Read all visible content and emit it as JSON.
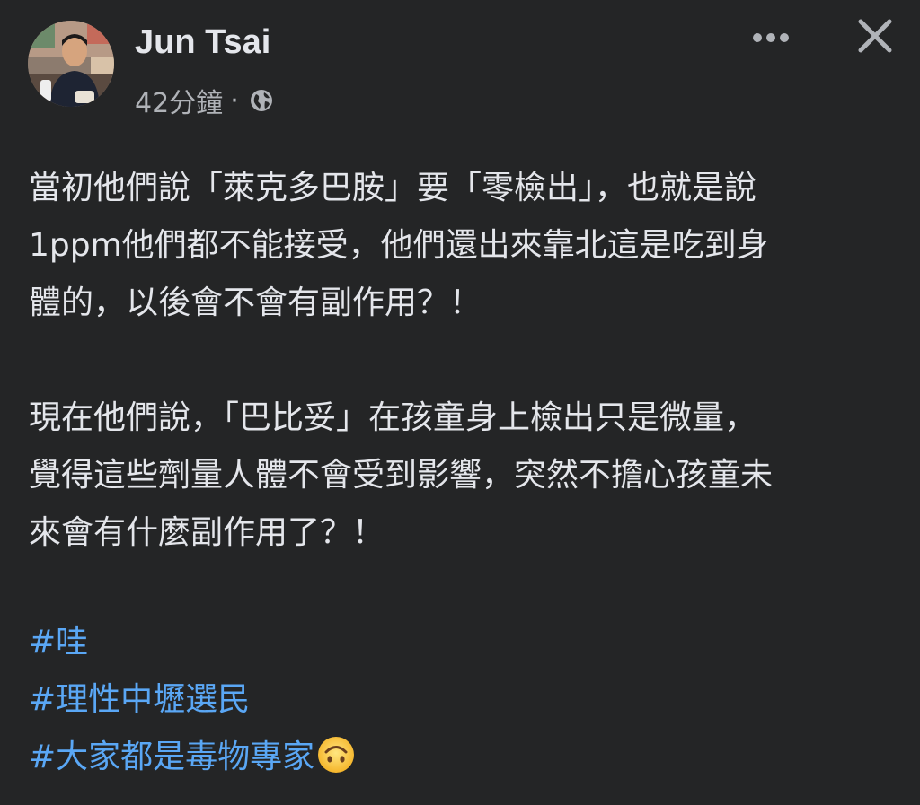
{
  "post": {
    "author": "Jun Tsai",
    "timestamp": "42分鐘",
    "separator": "·",
    "privacy_icon": "globe-icon",
    "paragraphs": [
      {
        "lines": [
          "當初他們說「萊克多巴胺」要「零檢出」，也就是說",
          "1ppm他們都不能接受，他們還出來靠北這是吃到身",
          "體的，以後會不會有副作用？！"
        ]
      },
      {
        "lines": [
          "現在他們說，「巴比妥」在孩童身上檢出只是微量，",
          "覺得這些劑量人體不會受到影響，突然不擔心孩童未",
          "來會有什麼副作用了？！"
        ]
      }
    ],
    "hashtags": [
      "#哇",
      "#理性中壢選民",
      "#大家都是毒物專家"
    ],
    "trailing_emoji": "upside-down-face-icon"
  },
  "toolbar": {
    "more_icon": "more-horizontal-icon",
    "close_icon": "close-icon"
  },
  "colors": {
    "background": "#242526",
    "text_primary": "#e4e6eb",
    "text_secondary": "#b0b3b8",
    "hashtag": "#5aa7f5"
  }
}
